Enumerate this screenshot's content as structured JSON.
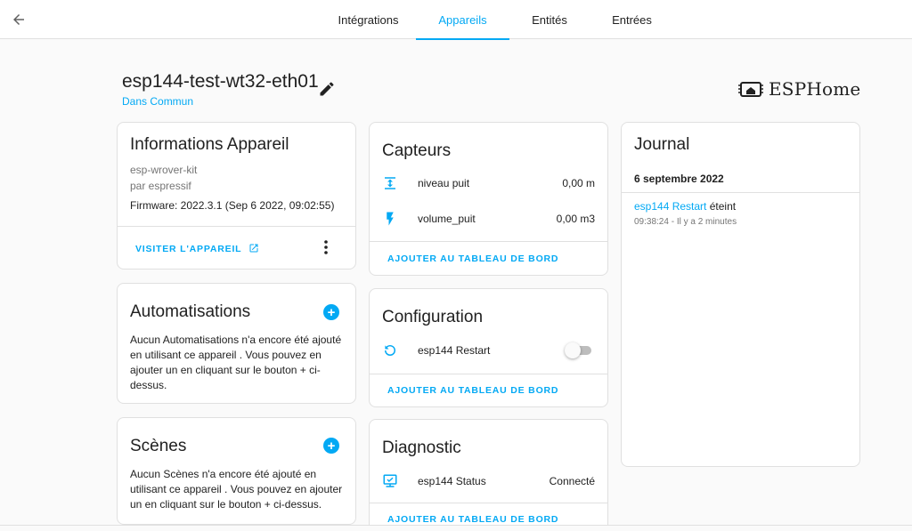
{
  "tabs": [
    {
      "label": "Intégrations"
    },
    {
      "label": "Appareils"
    },
    {
      "label": "Entités"
    },
    {
      "label": "Entrées"
    }
  ],
  "device": {
    "name": "esp144-test-wt32-eth01",
    "area": "Dans Commun",
    "brand": "ESPHome"
  },
  "info": {
    "title": "Informations Appareil",
    "model": "esp-wrover-kit",
    "manufacturer": "par espressif",
    "firmware": "Firmware: 2022.3.1 (Sep 6 2022, 09:02:55)",
    "visit_label": "VISITER L'APPAREIL"
  },
  "automations": {
    "title": "Automatisations",
    "text": "Aucun Automatisations n'a encore été ajouté en utilisant ce appareil . Vous pouvez en ajouter un en cliquant sur le bouton + ci-dessus."
  },
  "scenes": {
    "title": "Scènes",
    "text": "Aucun Scènes n'a encore été ajouté en utilisant ce appareil . Vous pouvez en ajouter un en cliquant sur le bouton + ci-dessus."
  },
  "sensors": {
    "title": "Capteurs",
    "items": [
      {
        "name": "niveau puit",
        "value": "0,00 m",
        "icon": "arrow-expand-vertical-icon"
      },
      {
        "name": "volume_puit",
        "value": "0,00 m3",
        "icon": "flash-icon"
      }
    ],
    "add_label": "AJOUTER AU TABLEAU DE BORD"
  },
  "configuration": {
    "title": "Configuration",
    "items": [
      {
        "name": "esp144 Restart",
        "icon": "restart-icon",
        "state": "off"
      }
    ],
    "add_label": "AJOUTER AU TABLEAU DE BORD"
  },
  "diagnostic": {
    "title": "Diagnostic",
    "items": [
      {
        "name": "esp144 Status",
        "value": "Connecté",
        "icon": "monitor-check-icon"
      }
    ],
    "add_label": "AJOUTER AU TABLEAU DE BORD"
  },
  "logbook": {
    "title": "Journal",
    "date": "6 septembre 2022",
    "entries": [
      {
        "entity": "esp144 Restart",
        "message": "éteint",
        "time": "09:38:24 - Il y a 2 minutes"
      }
    ]
  },
  "colors": {
    "accent": "#03a9f4",
    "text": "#212121",
    "muted": "#757575",
    "divider": "#e0e0e0",
    "background": "#fafafa"
  }
}
